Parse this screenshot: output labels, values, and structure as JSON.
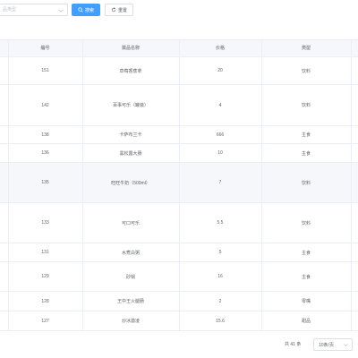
{
  "search": {
    "category_placeholder": "品类型",
    "search_label": "搜索",
    "reset_label": "重置"
  },
  "table": {
    "columns": [
      "编号",
      "菜品名称",
      "价格",
      "类型"
    ],
    "rows": [
      {
        "id": "151",
        "name": "草莓香蕉拿",
        "price": "20",
        "type": "饮料"
      },
      {
        "id": "142",
        "name": "百事可乐（罐装）",
        "price": "4",
        "type": "饮料"
      },
      {
        "id": "138",
        "name": "卡萨布兰卡",
        "price": "666",
        "type": "主食"
      },
      {
        "id": "136",
        "name": "黑松露大肠",
        "price": "10",
        "type": "主食"
      },
      {
        "id": "135",
        "name": "旺旺牛奶（500ml）",
        "price": "7",
        "type": "饮料"
      },
      {
        "id": "133",
        "name": "可口可乐",
        "price": "5.5",
        "type": "饮料"
      },
      {
        "id": "131",
        "name": "水煮白粥",
        "price": "5",
        "type": "主食"
      },
      {
        "id": "129",
        "name": "砂锅",
        "price": "16",
        "type": "主食"
      },
      {
        "id": "128",
        "name": "王中王火腿肠",
        "price": "2",
        "type": "零嘴"
      },
      {
        "id": "127",
        "name": "炒冰激凌",
        "price": "15.6",
        "type": "甜品"
      }
    ]
  },
  "pagination": {
    "total_text": "共 41 条",
    "page_size": "10条/页"
  }
}
